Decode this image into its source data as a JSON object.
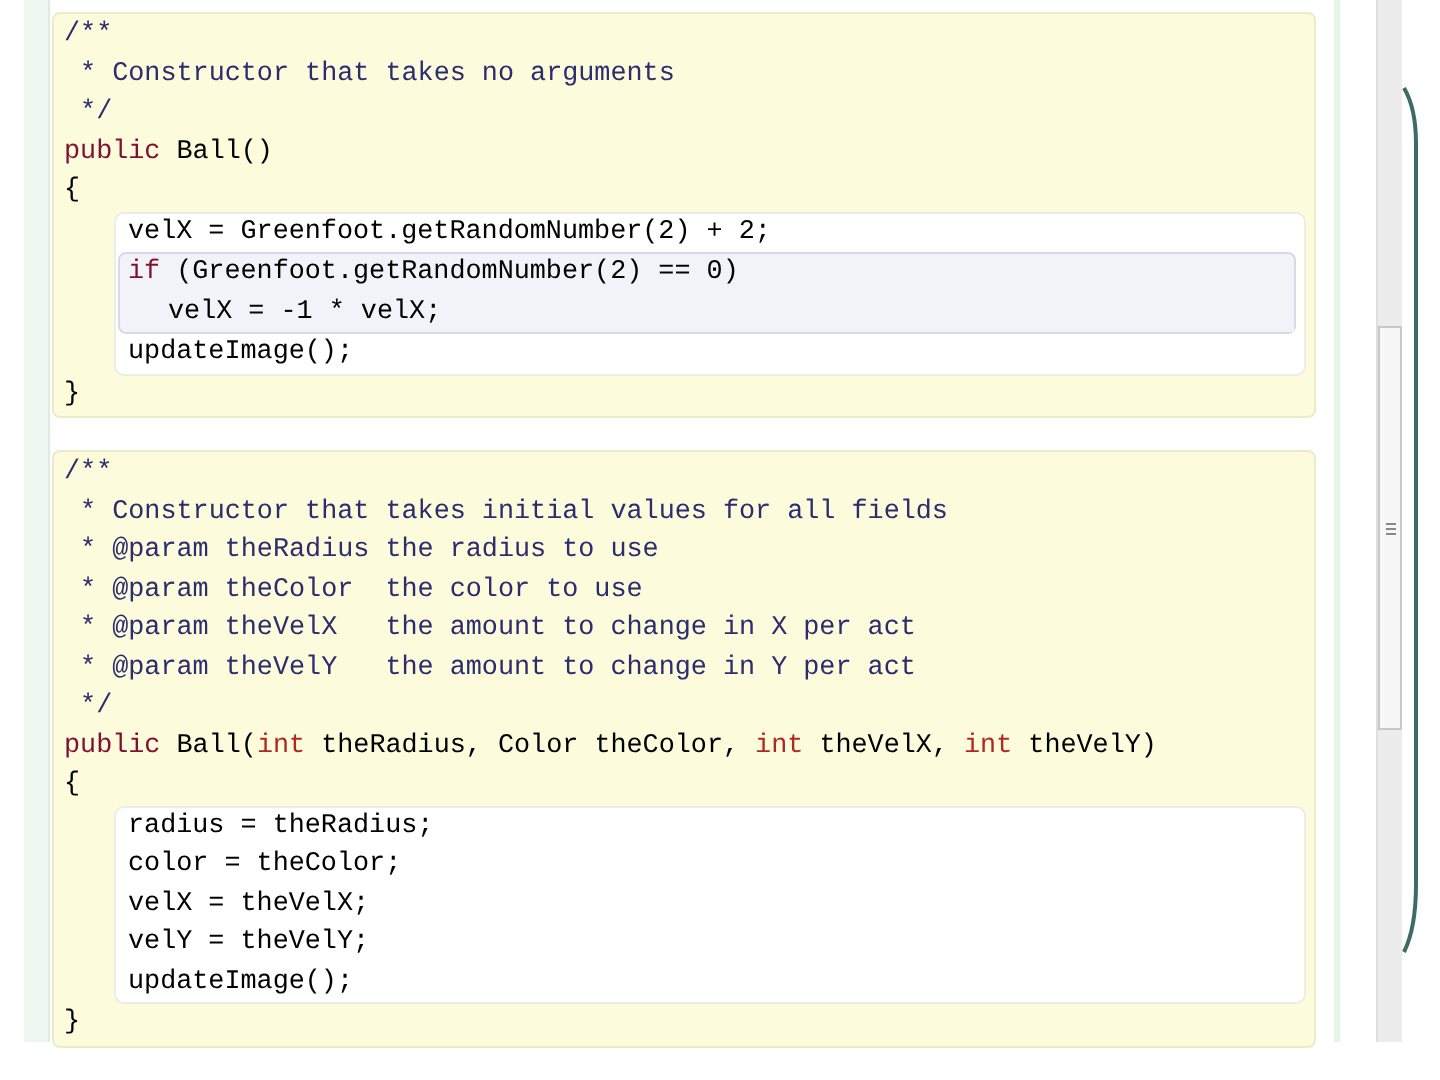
{
  "methods": [
    {
      "comment": [
        "/**",
        " * Constructor that takes no arguments",
        " */"
      ],
      "signature": [
        {
          "text": "public",
          "kind": "keyword"
        },
        {
          "text": " Ball()",
          "kind": "plain"
        }
      ],
      "open": "{",
      "body": [
        {
          "kind": "line",
          "tokens": [
            {
              "text": "velX = Greenfoot.getRandomNumber(2) + 2;",
              "kind": "plain"
            }
          ]
        },
        {
          "kind": "if",
          "header": [
            {
              "text": "if",
              "kind": "keyword"
            },
            {
              "text": " (Greenfoot.getRandomNumber(2) == 0)",
              "kind": "plain"
            }
          ],
          "body": [
            {
              "kind": "line",
              "tokens": [
                {
                  "text": "velX = -1 * velX;",
                  "kind": "plain"
                }
              ]
            }
          ]
        },
        {
          "kind": "line",
          "tokens": [
            {
              "text": "updateImage();",
              "kind": "plain"
            }
          ]
        }
      ],
      "close": "}"
    },
    {
      "comment": [
        "/**",
        " * Constructor that takes initial values for all fields",
        " * @param theRadius the radius to use",
        " * @param theColor  the color to use",
        " * @param theVelX   the amount to change in X per act",
        " * @param theVelY   the amount to change in Y per act",
        " */"
      ],
      "signature": [
        {
          "text": "public",
          "kind": "keyword"
        },
        {
          "text": " Ball(",
          "kind": "plain"
        },
        {
          "text": "int",
          "kind": "type"
        },
        {
          "text": " theRadius, Color theColor, ",
          "kind": "plain"
        },
        {
          "text": "int",
          "kind": "type"
        },
        {
          "text": " theVelX, ",
          "kind": "plain"
        },
        {
          "text": "int",
          "kind": "type"
        },
        {
          "text": " theVelY)",
          "kind": "plain"
        }
      ],
      "open": "{",
      "body": [
        {
          "kind": "line",
          "tokens": [
            {
              "text": "radius = theRadius;",
              "kind": "plain"
            }
          ]
        },
        {
          "kind": "line",
          "tokens": [
            {
              "text": "color = theColor;",
              "kind": "plain"
            }
          ]
        },
        {
          "kind": "line",
          "tokens": [
            {
              "text": "velX = theVelX;",
              "kind": "plain"
            }
          ]
        },
        {
          "kind": "line",
          "tokens": [
            {
              "text": "velY = theVelY;",
              "kind": "plain"
            }
          ]
        },
        {
          "kind": "line",
          "tokens": [
            {
              "text": "updateImage();",
              "kind": "plain"
            }
          ]
        }
      ],
      "close": "}"
    }
  ]
}
